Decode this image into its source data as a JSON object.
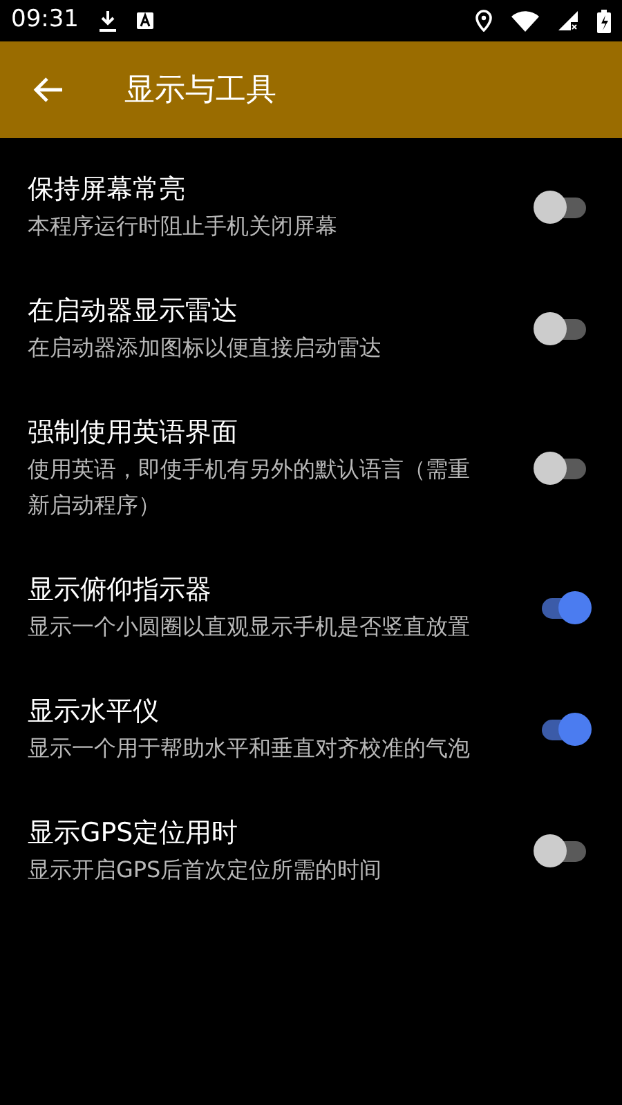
{
  "status_bar": {
    "time": "09:31"
  },
  "app_bar": {
    "title": "显示与工具"
  },
  "settings": [
    {
      "title": "保持屏幕常亮",
      "summary": "本程序运行时阻止手机关闭屏幕",
      "on": false
    },
    {
      "title": "在启动器显示雷达",
      "summary": "在启动器添加图标以便直接启动雷达",
      "on": false
    },
    {
      "title": "强制使用英语界面",
      "summary": "使用英语，即使手机有另外的默认语言（需重新启动程序）",
      "on": false
    },
    {
      "title": "显示俯仰指示器",
      "summary": "显示一个小圆圈以直观显示手机是否竖直放置",
      "on": true
    },
    {
      "title": "显示水平仪",
      "summary": "显示一个用于帮助水平和垂直对齐校准的气泡",
      "on": true
    },
    {
      "title": "显示GPS定位用时",
      "summary": "显示开启GPS后首次定位所需的时间",
      "on": false
    }
  ]
}
